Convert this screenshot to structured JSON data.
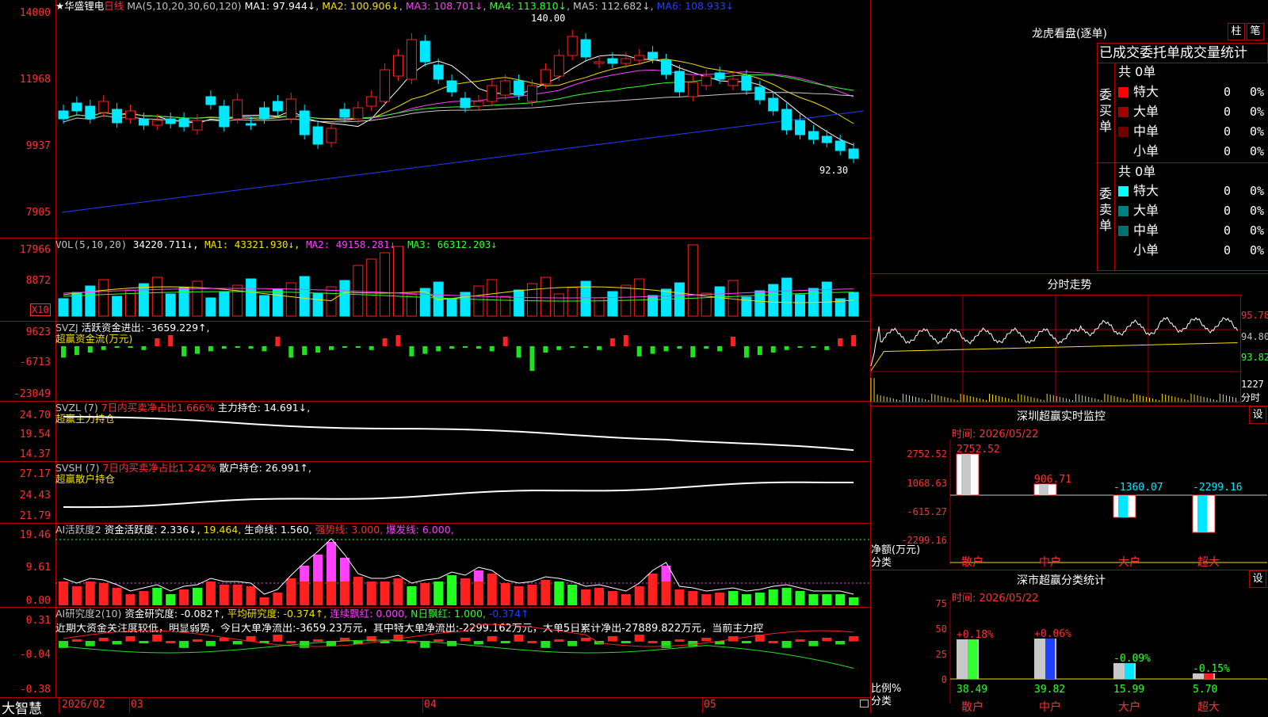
{
  "colors": {
    "up": "#ff2020",
    "down": "#00e8ff",
    "ma1": "#ffffff",
    "ma2": "#f5e000",
    "ma3": "#ff40ff",
    "ma4": "#30ff30",
    "ma5": "#c8c8c8",
    "ma6": "#2040ff",
    "grid": "#b00000"
  },
  "kline": {
    "stock": "★华盛锂电",
    "period": "日线",
    "ma_label": "MA(5,10,20,30,60,120)",
    "ma_values": [
      "MA1: 97.944↓",
      "MA2: 100.906↓",
      "MA3: 108.701↓",
      "MA4: 113.810↓",
      "MA5: 112.682↓",
      "MA6: 108.933↓"
    ],
    "y_ticks": [
      "14000",
      "11968",
      "9937",
      "7905"
    ],
    "high_mark": "140.00",
    "low_mark": "92.30"
  },
  "vol": {
    "label": "VOL(5,10,20)",
    "value": "34220.711↓,",
    "ma1": "MA1: 43321.930↓,",
    "ma2": "MA2: 49158.281↓,",
    "ma3": "MA3: 66312.203↓",
    "y_ticks": [
      "17966",
      "8872"
    ],
    "unit": "X10"
  },
  "svzj": {
    "label": "SVZJ",
    "text1": "活跃资金进出: -3659.229↑,",
    "text2": "超赢资金流(万元)",
    "y_ticks": [
      "9623",
      "-6713",
      "-23049"
    ]
  },
  "svzl": {
    "label": "SVZL (7)",
    "text1": "7日内买卖净占比1.666%",
    "text2": "主力持仓: 14.691↓,",
    "text3": "超赢主力持仓",
    "y_ticks": [
      "24.70",
      "19.54",
      "14.37"
    ]
  },
  "svsh": {
    "label": "SVSH (7)",
    "text1": "7日内买卖净占比1.242%",
    "text2": "散户持仓: 26.991↑,",
    "text3": "超赢散户持仓",
    "y_ticks": [
      "27.17",
      "24.43",
      "21.79"
    ]
  },
  "ai1": {
    "label": "AI活跃度2",
    "t1": "资金活跃度: 2.336↓,",
    "t2": "19.464,",
    "t3": "生命线: 1.560,",
    "t4": "强势线: 3.000,",
    "t5": "爆发线: 6.000,",
    "y_ticks": [
      "19.46",
      "9.61",
      "0.00"
    ]
  },
  "ai2": {
    "label": "AI研究度2(10)",
    "t1": "资金研究度: -0.082↑,",
    "t2": "平均研究度: -0.374↑,",
    "t3": "连续飘红: 0.000,",
    "t4": "N日飘红: 1.000,",
    "t5": "-0.374↑",
    "desc": "近期大资金关注度较低，明显弱势，今日大单净流出:-3659.23万元，其中特大单净流出:-2299.162万元，大单5日累计净出-27889.822万元，当前主力控",
    "y_ticks": [
      "0.31",
      "-0.04",
      "-0.38"
    ]
  },
  "bottom": {
    "brand": "大智慧",
    "dates": [
      "2026/02",
      "03",
      "04",
      "05"
    ]
  },
  "right": {
    "lhb_title": "龙虎看盘(逐单)",
    "btn1": "柱",
    "btn2": "笔",
    "lhb_subtitle": "已成交委托单成交量统计",
    "buy_label": [
      "委",
      "买",
      "单"
    ],
    "sell_label": [
      "委",
      "卖",
      "单"
    ],
    "buy_total": "共 0单",
    "sell_total": "共 0单",
    "rows": [
      {
        "name": "特大",
        "val": "0",
        "pct": "0%"
      },
      {
        "name": "大单",
        "val": "0",
        "pct": "0%"
      },
      {
        "name": "中单",
        "val": "0",
        "pct": "0%"
      },
      {
        "name": "小单",
        "val": "0",
        "pct": "0%"
      }
    ],
    "fs_title": "分时走势",
    "fs_ticks": [
      "95.78",
      "94.80",
      "93.82"
    ],
    "fs_vol_ticks": [
      "1227",
      "分时"
    ],
    "sz_title": "深圳超赢实时监控",
    "set_label": "设",
    "sz_time": "时间: 2026/05/22",
    "sz_ticks": [
      "2752.52",
      "1068.63",
      "-615.27",
      "-2299.16"
    ],
    "sz_values": [
      "2752.52",
      "906.71",
      "-1360.07",
      "-2299.16"
    ],
    "sz_ylabel": [
      "净额(万元)",
      "分类"
    ],
    "categories": [
      "散户",
      "中户",
      "大户",
      "超大"
    ],
    "sc_title": "深市超赢分类统计",
    "sc_time": "时间: 2026/05/22",
    "sc_ticks": [
      "75",
      "50",
      "25",
      "0"
    ],
    "sc_pcts": [
      "+0.18%",
      "+0.06%",
      "-0.09%",
      "-0.15%"
    ],
    "sc_values": [
      "38.49",
      "39.82",
      "15.99",
      "5.70"
    ],
    "sc_ylabel": [
      "比例%",
      "分类"
    ]
  }
}
